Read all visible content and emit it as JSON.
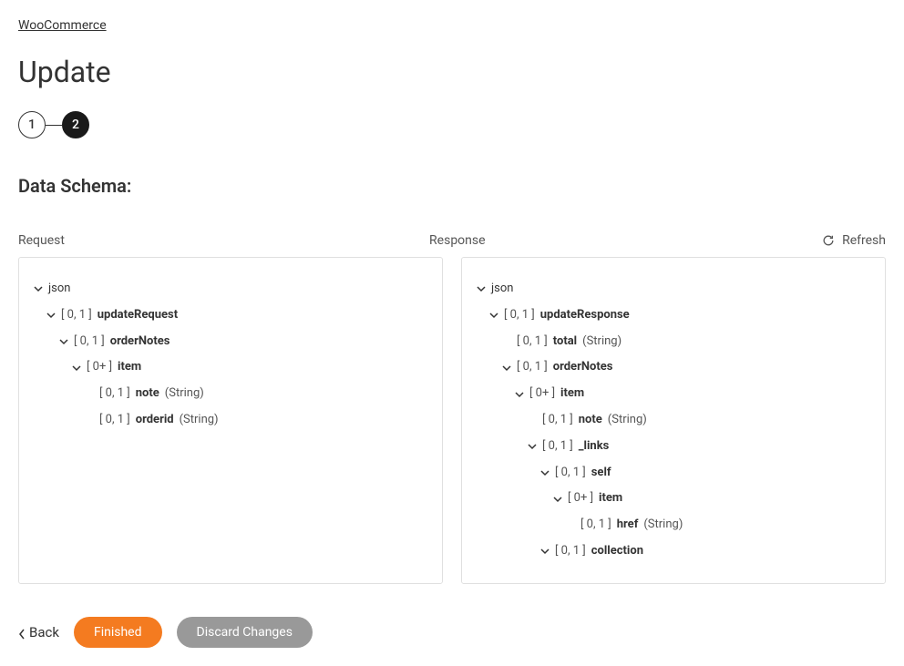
{
  "breadcrumb": {
    "link": "WooCommerce"
  },
  "page": {
    "title": "Update"
  },
  "stepper": {
    "steps": [
      "1",
      "2"
    ],
    "activeIndex": 1
  },
  "section": {
    "title": "Data Schema:"
  },
  "labels": {
    "request": "Request",
    "response": "Response",
    "refresh": "Refresh"
  },
  "request_tree": {
    "root": "json",
    "updateRequest_card": "[ 0, 1 ]",
    "updateRequest_name": "updateRequest",
    "orderNotes_card": "[ 0, 1 ]",
    "orderNotes_name": "orderNotes",
    "item_card": "[ 0+ ]",
    "item_name": "item",
    "note_card": "[ 0, 1 ]",
    "note_name": "note",
    "note_type": "(String)",
    "orderid_card": "[ 0, 1 ]",
    "orderid_name": "orderid",
    "orderid_type": "(String)"
  },
  "response_tree": {
    "root": "json",
    "updateResponse_card": "[ 0, 1 ]",
    "updateResponse_name": "updateResponse",
    "total_card": "[ 0, 1 ]",
    "total_name": "total",
    "total_type": "(String)",
    "orderNotes_card": "[ 0, 1 ]",
    "orderNotes_name": "orderNotes",
    "item_card": "[ 0+ ]",
    "item_name": "item",
    "note_card": "[ 0, 1 ]",
    "note_name": "note",
    "note_type": "(String)",
    "links_card": "[ 0, 1 ]",
    "links_name": "_links",
    "self_card": "[ 0, 1 ]",
    "self_name": "self",
    "selfItem_card": "[ 0+ ]",
    "selfItem_name": "item",
    "href_card": "[ 0, 1 ]",
    "href_name": "href",
    "href_type": "(String)",
    "collection_card": "[ 0, 1 ]",
    "collection_name": "collection"
  },
  "footer": {
    "back": "Back",
    "finished": "Finished",
    "discard": "Discard Changes"
  }
}
